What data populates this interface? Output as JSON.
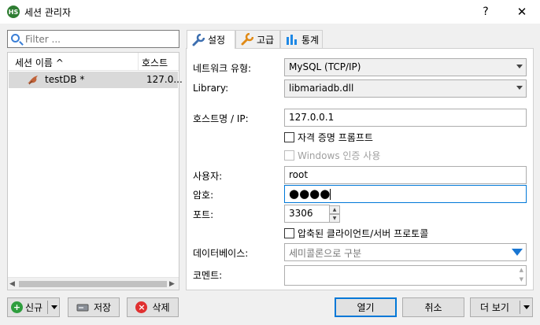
{
  "window": {
    "title": "세션 관리자",
    "app_icon_text": "HS",
    "help": "?",
    "close": "✕"
  },
  "filter": {
    "placeholder": "Filter ..."
  },
  "tree": {
    "col_name": "세션 이름 ^",
    "col_host": "호스트",
    "sessions": [
      {
        "name": "testDB *",
        "host": "127.0..."
      }
    ],
    "scroll_left": "◀",
    "scroll_right": "▶"
  },
  "tabs": [
    {
      "label": "설정"
    },
    {
      "label": "고급"
    },
    {
      "label": "통계"
    }
  ],
  "settings": {
    "network_type_label": "네트워크 유형:",
    "network_type_value": "MySQL (TCP/IP)",
    "library_label": "Library:",
    "library_value": "libmariadb.dll",
    "host_label": "호스트명 / IP:",
    "host_value": "127.0.0.1",
    "credential_prompt_label": "자격 증명 프롬프트",
    "windows_auth_label": "Windows 인증 사용",
    "user_label": "사용자:",
    "user_value": "root",
    "password_label": "암호:",
    "password_value": "●●●●",
    "port_label": "포트:",
    "port_value": "3306",
    "compressed_label": "압축된 클라이언트/서버 프로토콜",
    "database_label": "데이터베이스:",
    "database_placeholder": "세미콜론으로 구분",
    "comment_label": "코멘트:"
  },
  "buttons": {
    "new": "신규",
    "save": "저장",
    "delete": "삭제",
    "open": "열기",
    "cancel": "취소",
    "more": "더 보기"
  },
  "colors": {
    "accent": "#0078d7",
    "tree_selected": "#d9d9d9",
    "new_icon": "#2e9e3e",
    "delete_icon": "#e03030"
  }
}
